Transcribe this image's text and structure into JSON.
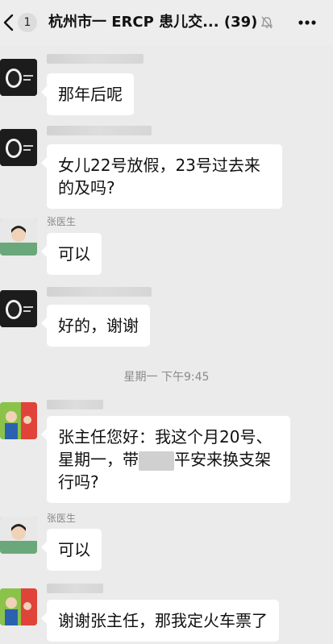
{
  "header": {
    "unread_count": "1",
    "title": "杭州市一 ERCP 患儿交... (39)",
    "icons": [
      "back-arrow-icon",
      "mute-bell-icon",
      "more-dots-icon"
    ]
  },
  "messages": [
    {
      "sender": "",
      "text": "那年后呢"
    },
    {
      "sender": "",
      "text": "女儿22号放假，23号过去来的及吗?"
    },
    {
      "sender": "张医生",
      "text": "可以"
    },
    {
      "sender": "",
      "text": "好的，谢谢"
    },
    {
      "sender": "",
      "text_before": "张主任您好：我这个月20号、星期一，带",
      "text_after": "平安来换支架行吗?"
    },
    {
      "sender": "张医生",
      "text": "可以"
    },
    {
      "sender": "",
      "text": "谢谢张主任，那我定火车票了"
    }
  ],
  "timestamp": "星期一 下午9:45",
  "colors": {
    "chat_bg": "#ebebeb",
    "bubble": "#ffffff",
    "topbar": "#ededed"
  }
}
